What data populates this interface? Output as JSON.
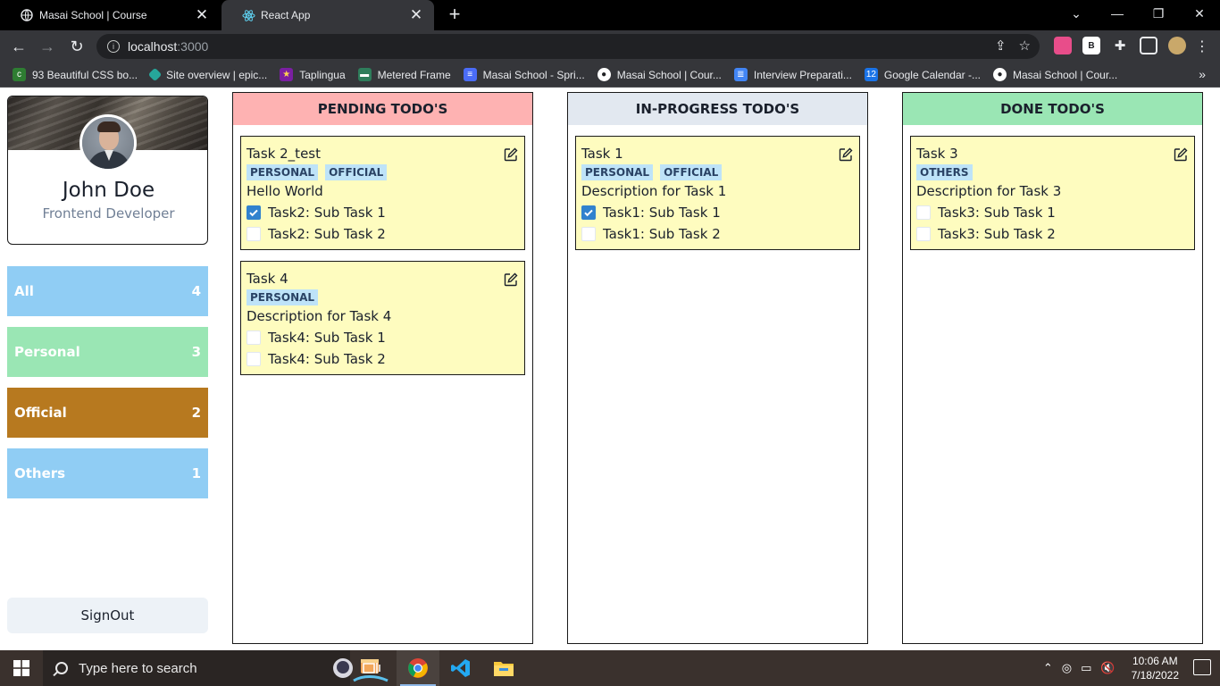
{
  "browser": {
    "tabs": [
      {
        "title": "Masai School | Course",
        "favicon": "globe-icon",
        "active": false
      },
      {
        "title": "React App",
        "favicon": "react-icon",
        "active": true
      }
    ],
    "url_host": "localhost",
    "url_port": ":3000",
    "bookmarks": [
      {
        "label": "93 Beautiful CSS bo...",
        "icon": "css-icon",
        "color": "#2e7d32"
      },
      {
        "label": "Site overview | epic...",
        "icon": "diamond-icon",
        "color": "#26a69a"
      },
      {
        "label": "Taplingua",
        "icon": "star-icon",
        "color": "#7b1fa2"
      },
      {
        "label": "Metered Frame",
        "icon": "frame-icon",
        "color": "#2e7d5b"
      },
      {
        "label": "Masai School - Spri...",
        "icon": "sprint-icon",
        "color": "#4a6cf7"
      },
      {
        "label": "Masai School | Cour...",
        "icon": "globe-icon",
        "color": "#ffffff"
      },
      {
        "label": "Interview Preparati...",
        "icon": "docs-icon",
        "color": "#4285f4"
      },
      {
        "label": "Google Calendar -...",
        "icon": "calendar-icon",
        "color": "#1a73e8"
      },
      {
        "label": "Masai School | Cour...",
        "icon": "globe-icon",
        "color": "#ffffff"
      }
    ]
  },
  "profile": {
    "name": "John Doe",
    "role": "Frontend Developer"
  },
  "filters": [
    {
      "label": "All",
      "count": "4",
      "color": "#90cdf4"
    },
    {
      "label": "Personal",
      "count": "3",
      "color": "#9ae6b4"
    },
    {
      "label": "Official",
      "count": "2",
      "color": "#b7791f"
    },
    {
      "label": "Others",
      "count": "1",
      "color": "#90cdf4"
    }
  ],
  "signout_label": "SignOut",
  "columns": {
    "pending": {
      "title": "PENDING TODO'S",
      "color": "#feb2b2",
      "cards": [
        {
          "title": "Task 2_test",
          "tags": [
            "PERSONAL",
            "OFFICIAL"
          ],
          "description": "Hello World",
          "subtasks": [
            {
              "label": "Task2: Sub Task 1",
              "checked": true
            },
            {
              "label": "Task2: Sub Task 2",
              "checked": false
            }
          ]
        },
        {
          "title": "Task 4",
          "tags": [
            "PERSONAL"
          ],
          "description": "Description for Task 4",
          "subtasks": [
            {
              "label": "Task4: Sub Task 1",
              "checked": false
            },
            {
              "label": "Task4: Sub Task 2",
              "checked": false
            }
          ]
        }
      ]
    },
    "in_progress": {
      "title": "IN-PROGRESS TODO'S",
      "color": "#e2e8f0",
      "cards": [
        {
          "title": "Task 1",
          "tags": [
            "PERSONAL",
            "OFFICIAL"
          ],
          "description": "Description for Task 1",
          "subtasks": [
            {
              "label": "Task1: Sub Task 1",
              "checked": true
            },
            {
              "label": "Task1: Sub Task 2",
              "checked": false
            }
          ]
        }
      ]
    },
    "done": {
      "title": "DONE TODO'S",
      "color": "#9ae6b4",
      "cards": [
        {
          "title": "Task 3",
          "tags": [
            "OTHERS"
          ],
          "description": "Description for Task 3",
          "subtasks": [
            {
              "label": "Task3: Sub Task 1",
              "checked": false
            },
            {
              "label": "Task3: Sub Task 2",
              "checked": false
            }
          ]
        }
      ]
    }
  },
  "taskbar": {
    "search_placeholder": "Type here to search",
    "time": "10:06 AM",
    "date": "7/18/2022"
  }
}
